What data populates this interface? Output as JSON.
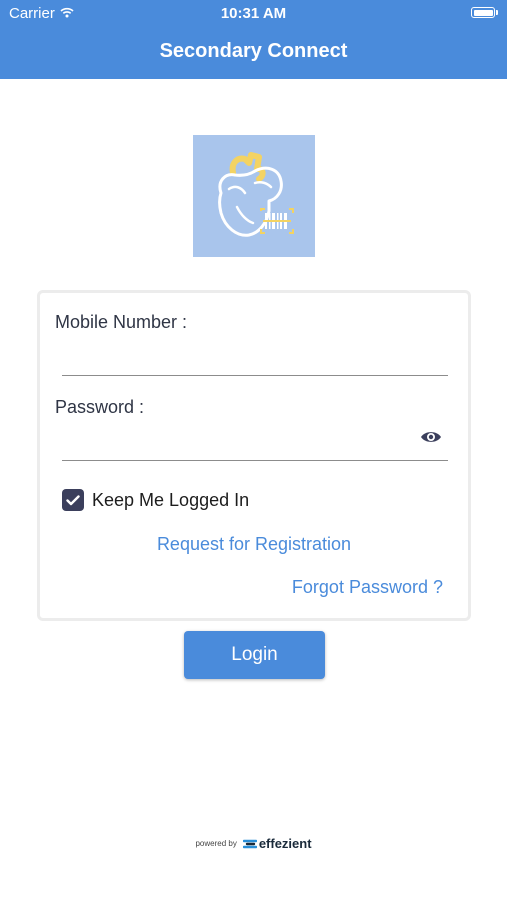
{
  "status_bar": {
    "carrier": "Carrier",
    "time": "10:31 AM"
  },
  "header": {
    "title": "Secondary Connect",
    "background_color": "#4a8bdb"
  },
  "logo": {
    "icon": "heart-barcode-logo",
    "background_color": "#a9c5ec"
  },
  "form": {
    "mobile_label": "Mobile Number :",
    "mobile_value": "",
    "password_label": "Password :",
    "password_value": "",
    "show_password_icon": "eye-icon",
    "keep_logged_in_label": "Keep Me Logged In",
    "keep_logged_in_checked": true,
    "register_link": "Request for Registration",
    "forgot_link": "Forgot Password ?"
  },
  "login_button": {
    "label": "Login"
  },
  "footer": {
    "powered_by": "powered by",
    "brand": "effezient"
  }
}
